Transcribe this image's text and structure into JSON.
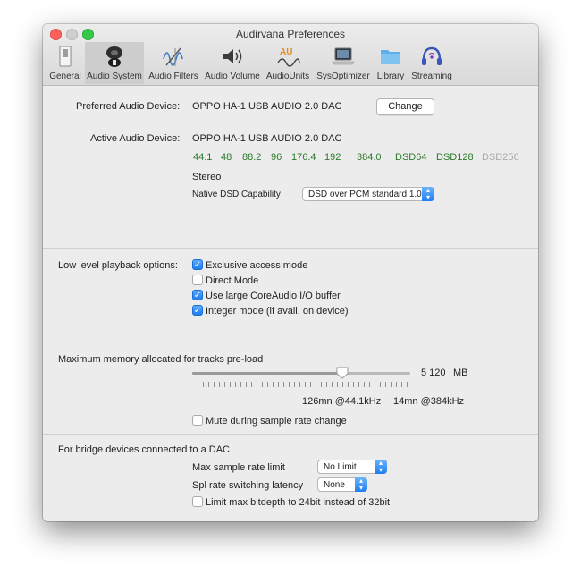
{
  "window": {
    "title": "Audirvana Preferences"
  },
  "toolbar": {
    "items": [
      {
        "label": "General",
        "icon": "general-switch-icon"
      },
      {
        "label": "Audio System",
        "icon": "speaker-icon"
      },
      {
        "label": "Audio Filters",
        "icon": "waveform-icon"
      },
      {
        "label": "Audio Volume",
        "icon": "volume-icon"
      },
      {
        "label": "AudioUnits",
        "icon": "audiounits-icon"
      },
      {
        "label": "SysOptimizer",
        "icon": "laptop-icon"
      },
      {
        "label": "Library",
        "icon": "folder-icon"
      },
      {
        "label": "Streaming",
        "icon": "headphones-icon"
      }
    ],
    "selected": "Audio System"
  },
  "device": {
    "preferred_label": "Preferred Audio Device:",
    "preferred_value": "OPPO HA-1 USB AUDIO 2.0 DAC",
    "change_button": "Change",
    "active_label": "Active Audio Device:",
    "active_value": "OPPO HA-1 USB AUDIO 2.0 DAC",
    "rates": [
      {
        "text": "44.1",
        "enabled": true
      },
      {
        "text": "48",
        "enabled": true
      },
      {
        "text": "88.2",
        "enabled": true
      },
      {
        "text": "96",
        "enabled": true
      },
      {
        "text": "176.4",
        "enabled": true
      },
      {
        "text": "192",
        "enabled": true
      },
      {
        "text": "384.0",
        "enabled": true
      },
      {
        "text": "DSD64",
        "enabled": true
      },
      {
        "text": "DSD128",
        "enabled": true
      },
      {
        "text": "DSD256",
        "enabled": false
      }
    ],
    "channels": "Stereo",
    "dsd_label": "Native DSD Capability",
    "dsd_value": "DSD over PCM standard 1.0"
  },
  "playback": {
    "label": "Low level playback options:",
    "options": [
      {
        "label": "Exclusive access mode",
        "checked": true
      },
      {
        "label": "Direct Mode",
        "checked": false
      },
      {
        "label": "Use large CoreAudio I/O buffer",
        "checked": true
      },
      {
        "label": "Integer mode (if avail. on device)",
        "checked": true
      }
    ]
  },
  "memory": {
    "label": "Maximum memory allocated for tracks pre-load",
    "value_text": "5 120",
    "unit": "MB",
    "slider_fraction": 0.69,
    "duration_44": "126mn @44.1kHz",
    "duration_384": "14mn @384kHz",
    "mute_label": "Mute during sample rate change",
    "mute_checked": false
  },
  "bridge": {
    "label": "For bridge devices connected to a DAC",
    "max_rate_label": "Max sample rate limit",
    "max_rate_value": "No Limit",
    "latency_label": "Spl rate switching latency",
    "latency_value": "None",
    "bitdepth_label": "Limit max bitdepth to 24bit instead of 32bit",
    "bitdepth_checked": false
  },
  "colors": {
    "rate_enabled": "#2b7a2b",
    "rate_disabled": "#a9a9a9",
    "accent": "#1e7ef4"
  }
}
